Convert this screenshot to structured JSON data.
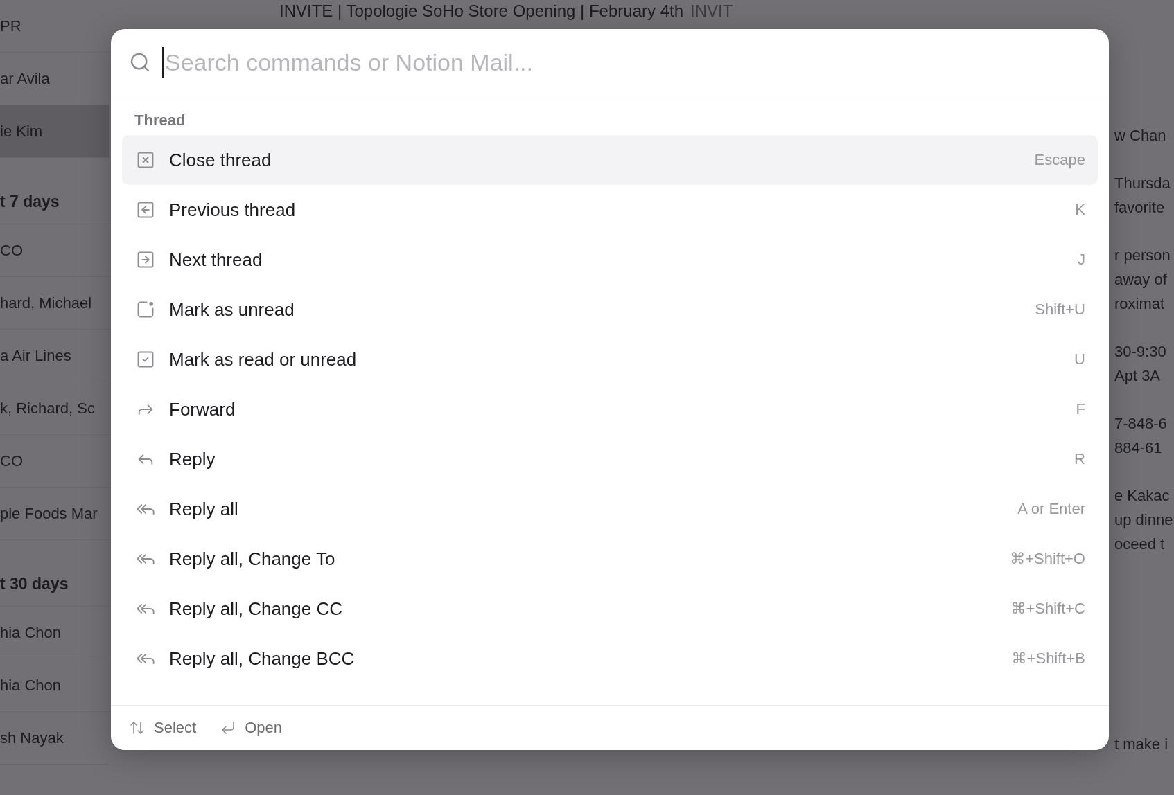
{
  "inbox_list": [
    {
      "kind": "row",
      "text": "PR",
      "selected": false
    },
    {
      "kind": "row",
      "text": "ar Avila",
      "selected": false
    },
    {
      "kind": "row",
      "text": "ie Kim",
      "selected": true
    },
    {
      "kind": "header",
      "text": "t 7 days",
      "selected": false
    },
    {
      "kind": "row",
      "text": "CO",
      "selected": false
    },
    {
      "kind": "row",
      "text": "hard, Michael",
      "selected": false
    },
    {
      "kind": "row",
      "text": "a Air Lines",
      "selected": false
    },
    {
      "kind": "row",
      "text": "k, Richard, Sc",
      "selected": false
    },
    {
      "kind": "row",
      "text": "CO",
      "selected": false
    },
    {
      "kind": "row",
      "text": "ple Foods Mar",
      "selected": false
    },
    {
      "kind": "header",
      "text": "t 30 days",
      "selected": false
    },
    {
      "kind": "row",
      "text": "hia Chon",
      "selected": false
    },
    {
      "kind": "row",
      "text": "hia Chon",
      "selected": false
    },
    {
      "kind": "row",
      "text": "sh Nayak",
      "selected": false
    }
  ],
  "subject_line": {
    "subject": "INVITE | Topologie SoHo Store Opening | February 4th",
    "preview": "INVIT"
  },
  "reading_pane": {
    "paragraphs": [
      [
        "w Chan"
      ],
      [
        "Thursda",
        "favorite"
      ],
      [
        "r person",
        "away of",
        "roximat"
      ],
      [
        "30-9:30",
        "Apt 3A"
      ],
      [
        "7-848-6",
        "884-61"
      ],
      [
        "e Kakac",
        "up dinne",
        "oceed t"
      ]
    ],
    "footer_text": "t make i"
  },
  "command_palette": {
    "search": {
      "placeholder": "Search commands or Notion Mail..."
    },
    "section": "Thread",
    "commands": [
      {
        "kind": "close",
        "label": "Close thread",
        "shortcut": "Escape",
        "selected": true
      },
      {
        "kind": "previous",
        "label": "Previous thread",
        "shortcut": "K",
        "selected": false
      },
      {
        "kind": "next",
        "label": "Next thread",
        "shortcut": "J",
        "selected": false
      },
      {
        "kind": "unread",
        "label": "Mark as unread",
        "shortcut": "Shift+U",
        "selected": false
      },
      {
        "kind": "toggle-read",
        "label": "Mark as read or unread",
        "shortcut": "U",
        "selected": false
      },
      {
        "kind": "forward",
        "label": "Forward",
        "shortcut": "F",
        "selected": false
      },
      {
        "kind": "reply",
        "label": "Reply",
        "shortcut": "R",
        "selected": false
      },
      {
        "kind": "reply-all",
        "label": "Reply all",
        "shortcut": "A or Enter",
        "selected": false
      },
      {
        "kind": "reply-all",
        "label": "Reply all, Change To",
        "shortcut": "⌘+Shift+O",
        "selected": false
      },
      {
        "kind": "reply-all",
        "label": "Reply all, Change CC",
        "shortcut": "⌘+Shift+C",
        "selected": false
      },
      {
        "kind": "reply-all",
        "label": "Reply all, Change BCC",
        "shortcut": "⌘+Shift+B",
        "selected": false
      }
    ],
    "footer": [
      {
        "kind": "select",
        "label": "Select"
      },
      {
        "kind": "open",
        "label": "Open"
      }
    ]
  }
}
